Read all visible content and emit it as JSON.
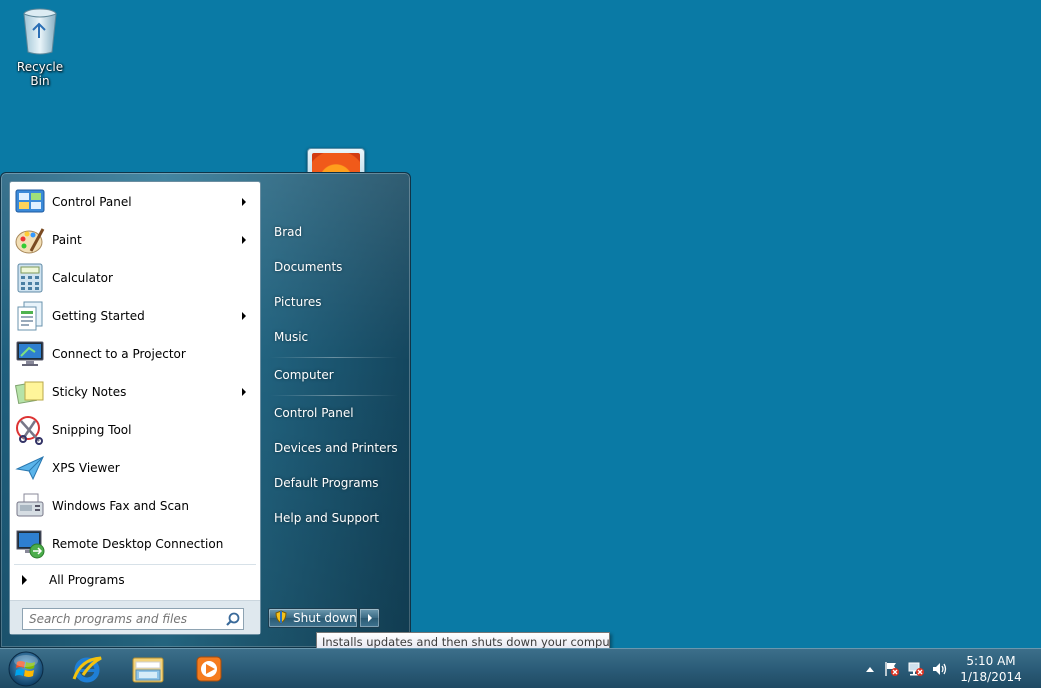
{
  "desktop": {
    "icons": [
      {
        "label": "Recycle Bin",
        "icon": "recycle-bin-icon"
      }
    ]
  },
  "start_menu": {
    "programs": [
      {
        "label": "Control Panel",
        "icon": "control-panel-icon",
        "submenu": true
      },
      {
        "label": "Paint",
        "icon": "paint-icon",
        "submenu": true
      },
      {
        "label": "Calculator",
        "icon": "calculator-icon",
        "submenu": false
      },
      {
        "label": "Getting Started",
        "icon": "getting-started-icon",
        "submenu": true
      },
      {
        "label": "Connect to a Projector",
        "icon": "projector-icon",
        "submenu": false
      },
      {
        "label": "Sticky Notes",
        "icon": "sticky-notes-icon",
        "submenu": true
      },
      {
        "label": "Snipping Tool",
        "icon": "snipping-tool-icon",
        "submenu": false
      },
      {
        "label": "XPS Viewer",
        "icon": "xps-viewer-icon",
        "submenu": false
      },
      {
        "label": "Windows Fax and Scan",
        "icon": "fax-scan-icon",
        "submenu": false
      },
      {
        "label": "Remote Desktop Connection",
        "icon": "remote-desktop-icon",
        "submenu": false
      }
    ],
    "all_programs_label": "All Programs",
    "search_placeholder": "Search programs and files",
    "right_items": [
      "Brad",
      "Documents",
      "Pictures",
      "Music",
      "Computer",
      "Control Panel",
      "Devices and Printers",
      "Default Programs",
      "Help and Support"
    ],
    "shutdown_label": "Shut down",
    "tooltip": "Installs updates and then shuts down your computer."
  },
  "taskbar": {
    "pinned": [
      "internet-explorer-icon",
      "windows-explorer-icon",
      "media-player-icon"
    ],
    "tray_icons": [
      "show-hidden-icons-icon",
      "action-center-icon",
      "network-icon",
      "volume-icon"
    ],
    "clock_time": "5:10 AM",
    "clock_date": "1/18/2014"
  }
}
